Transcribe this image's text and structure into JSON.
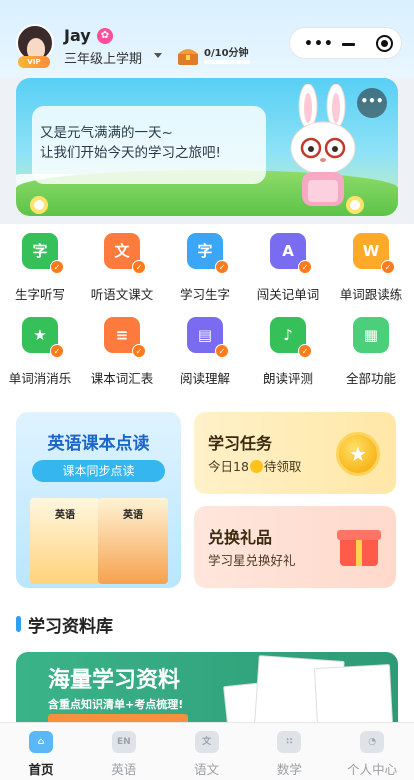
{
  "header": {
    "user_name": "Jay",
    "vip_badge": "VIP",
    "grade": "三年级上学期",
    "study_time": "0/10分钟",
    "study_progress": 0
  },
  "banner": {
    "line1": "又是元气满满的一天~",
    "line2": "让我们开始今天的学习之旅吧!"
  },
  "features": [
    {
      "label": "生字听写",
      "icon": "字",
      "color": "#35c05a"
    },
    {
      "label": "听语文课文",
      "icon": "文",
      "color": "#ff7a3d"
    },
    {
      "label": "学习生字",
      "icon": "字",
      "color": "#3aa6f5"
    },
    {
      "label": "闯关记单词",
      "icon": "A",
      "color": "#7a6cf0"
    },
    {
      "label": "单词跟读练",
      "icon": "W",
      "color": "#ffa92a"
    },
    {
      "label": "单词消消乐",
      "icon": "★",
      "color": "#35c05a"
    },
    {
      "label": "课本词汇表",
      "icon": "≡",
      "color": "#ff7a3d"
    },
    {
      "label": "阅读理解",
      "icon": "▤",
      "color": "#7a6cf0"
    },
    {
      "label": "朗读评测",
      "icon": "♪",
      "color": "#35c05a"
    },
    {
      "label": "全部功能",
      "icon": "▦",
      "color": "#4ccf7a"
    }
  ],
  "cards": {
    "reader_title": "英语课本点读",
    "reader_sub": "课本同步点读",
    "book_label": "英语",
    "task_title": "学习任务",
    "task_sub_prefix": "今日18",
    "task_sub_suffix": "待领取",
    "gift_title": "兑换礼品",
    "gift_sub": "学习星兑换好礼"
  },
  "library": {
    "title": "学习资料库",
    "banner_big": "海量学习资料",
    "banner_small": "含重点知识清单+考点梳理!"
  },
  "tabs": [
    {
      "label": "首页",
      "icon": "home-icon",
      "glyph": "⌂",
      "active": true
    },
    {
      "label": "英语",
      "icon": "english-icon",
      "glyph": "EN",
      "active": false
    },
    {
      "label": "语文",
      "icon": "chinese-icon",
      "glyph": "文",
      "active": false
    },
    {
      "label": "数学",
      "icon": "math-icon",
      "glyph": "∷",
      "active": false
    },
    {
      "label": "个人中心",
      "icon": "profile-icon",
      "glyph": "◔",
      "active": false
    }
  ]
}
